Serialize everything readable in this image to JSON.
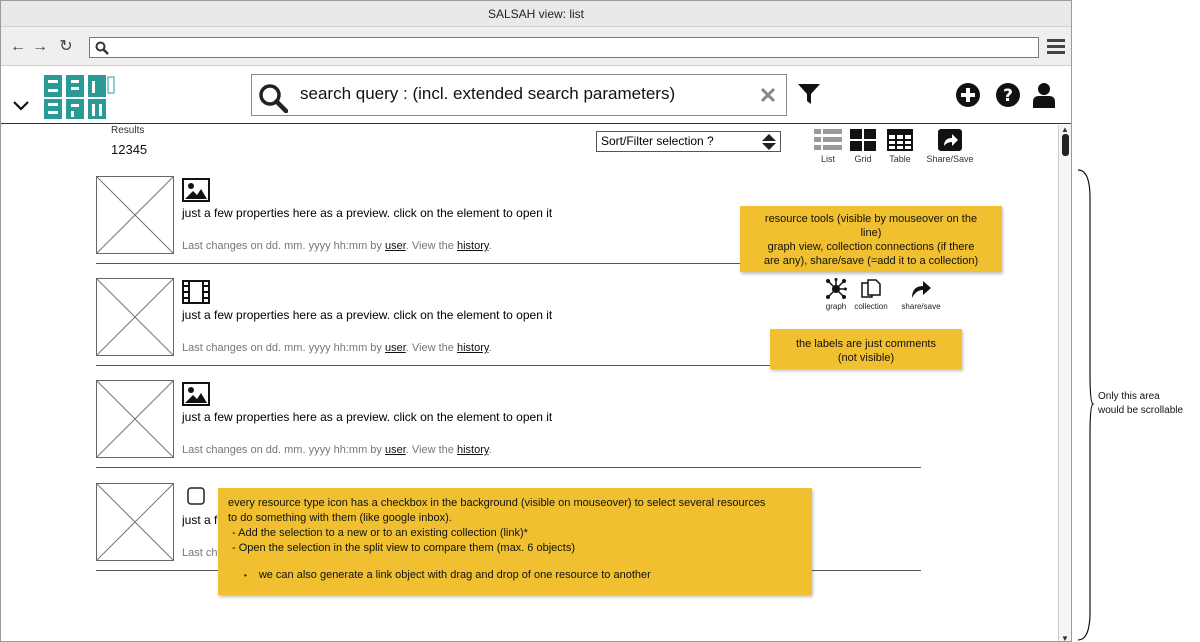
{
  "window": {
    "title": "SALSAH view: list"
  },
  "browser": {
    "url": ""
  },
  "header": {
    "search_query": "search query : (incl. extended search parameters)"
  },
  "results": {
    "label": "Results",
    "count": "12345"
  },
  "sort": {
    "selected": "Sort/Filter selection ?"
  },
  "views": [
    {
      "label": "List",
      "icon": "list-view-icon"
    },
    {
      "label": "Grid",
      "icon": "grid-view-icon"
    },
    {
      "label": "Table",
      "icon": "table-view-icon"
    },
    {
      "label": "Share/Save",
      "icon": "share-save-icon"
    }
  ],
  "items": [
    {
      "type_icon": "image-icon",
      "description": "just a few properties here as a preview. click on the element to open it",
      "meta_prefix": "Last changes on dd. mm. yyyy hh:mm by ",
      "meta_user": "user",
      "meta_mid": ". View the ",
      "meta_history": "history",
      "meta_end": "."
    },
    {
      "type_icon": "film-icon",
      "description": "just a few properties here as a preview. click on the element to open it",
      "meta_prefix": "Last changes on dd. mm. yyyy hh:mm by ",
      "meta_user": "user",
      "meta_mid": ". View the ",
      "meta_history": "history",
      "meta_end": "."
    },
    {
      "type_icon": "image-icon",
      "description": "just a few properties here as a preview. click on the element to open it",
      "meta_prefix": "Last changes on dd. mm. yyyy hh:mm by ",
      "meta_user": "user",
      "meta_mid": ". View the ",
      "meta_history": "history",
      "meta_end": "."
    },
    {
      "type_icon": "checkbox-icon",
      "description": "just a f",
      "meta_prefix": "Last ch"
    }
  ],
  "resource_tools": [
    {
      "label": "graph",
      "icon": "graph-icon"
    },
    {
      "label": "collection",
      "icon": "collection-icon"
    },
    {
      "label": "share/save",
      "icon": "share-icon"
    }
  ],
  "notes": {
    "resource_tools": [
      "resource tools (visible by mouseover on the",
      "line)",
      "graph view, collection connections (if there",
      "are any), share/save (=add it to a collection)"
    ],
    "labels": [
      "the labels are just comments",
      "(not visible)"
    ],
    "checkbox": [
      "every resource type icon has a checkbox in the background (visible on mouseover) to select several resources",
      "to do something with them (like google inbox).",
      "- Add the selection to a new or to an existing collection (link)*",
      "- Open the selection in the split view to compare them (max. 6 objects)",
      "we can also generate a link object with drag and drop of one resource to another"
    ],
    "scroll": [
      "Only this area",
      "would be scrollable"
    ]
  },
  "colors": {
    "note": "#f0c030",
    "logo": "#2a9a97"
  }
}
